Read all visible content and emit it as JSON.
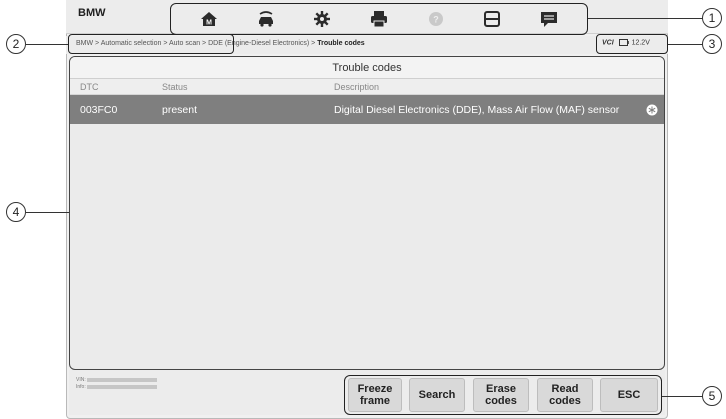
{
  "header": {
    "brand": "BMW"
  },
  "toolbar": {
    "buttons": [
      {
        "icon": "home-icon"
      },
      {
        "icon": "vehicle-swap-icon"
      },
      {
        "icon": "settings-icon"
      },
      {
        "icon": "print-icon"
      },
      {
        "icon": "help-icon"
      },
      {
        "icon": "save-icon"
      },
      {
        "icon": "data-logging-icon"
      }
    ]
  },
  "breadcrumb": {
    "path": "BMW > Automatic selection > Auto scan > DDE (Engine-Diesel Electronics) > ",
    "current": "Trouble codes"
  },
  "status": {
    "vci_label": "VCI",
    "battery_voltage": "12.2V"
  },
  "panel": {
    "title": "Trouble codes",
    "columns": {
      "dtc": "DTC",
      "status": "Status",
      "description": "Description"
    },
    "rows": [
      {
        "dtc": "003FC0",
        "status": "present",
        "description": "Digital Diesel Electronics (DDE), Mass Air Flow (MAF) sensor",
        "icon": "snowflake-icon"
      }
    ]
  },
  "vehicle_info": {
    "vin_label": "VIN:",
    "info_label": "Info:"
  },
  "function_buttons": {
    "freeze_frame": "Freeze frame",
    "search": "Search",
    "erase_codes": "Erase codes",
    "read_codes": "Read codes",
    "esc": "ESC"
  },
  "callouts": [
    "1",
    "2",
    "3",
    "4",
    "5"
  ],
  "colors": {
    "selected_row": "#7f7f7f",
    "panel_bg": "#ebebeb",
    "button_bg": "#d9d9d9"
  }
}
